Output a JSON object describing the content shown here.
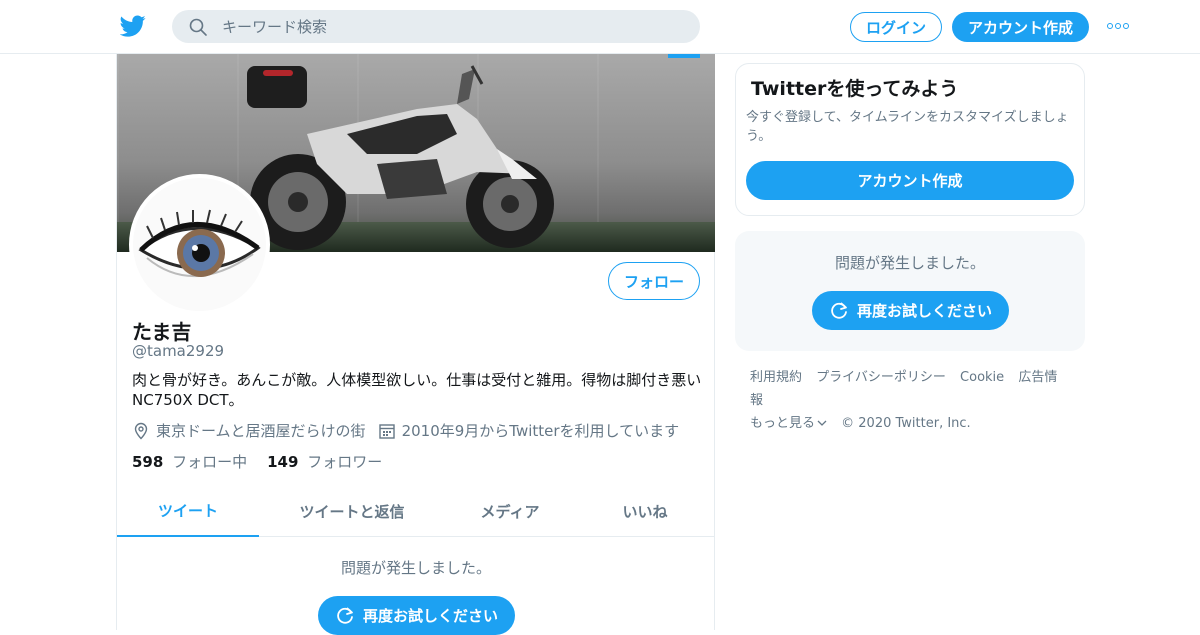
{
  "header": {
    "search_placeholder": "キーワード検索",
    "login_label": "ログイン",
    "signup_label": "アカウント作成",
    "more_icon": "more-dots-icon"
  },
  "profile": {
    "name": "たま吉",
    "handle": "@tama2929",
    "bio": "肉と骨が好き。あんこが敵。人体模型欲しい。仕事は受付と雑用。得物は脚付き悪いNC750X DCT。",
    "location": "東京ドームと居酒屋だらけの街",
    "joined": "2010年9月からTwitterを利用しています",
    "following_count": "598",
    "following_label": "フォロー中",
    "followers_count": "149",
    "followers_label": "フォロワー",
    "follow_label": "フォロー"
  },
  "tabs": [
    {
      "label": "ツイート"
    },
    {
      "label": "ツイートと返信"
    },
    {
      "label": "メディア"
    },
    {
      "label": "いいね"
    }
  ],
  "timeline": {
    "error_text": "問題が発生しました。",
    "retry_label": "再度お試しください"
  },
  "sidebar": {
    "card_title": "Twitterを使ってみよう",
    "card_text": "今すぐ登録して、タイムラインをカスタマイズしましょう。",
    "card_button": "アカウント作成",
    "error_text": "問題が発生しました。",
    "retry_label": "再度お試しください"
  },
  "footer": {
    "links": [
      "利用規約",
      "プライバシーポリシー",
      "Cookie",
      "広告情報"
    ],
    "more_label": "もっと見る",
    "copyright": "© 2020 Twitter, Inc."
  },
  "colors": {
    "accent": "#1da1f2",
    "secondary_text": "#657786",
    "border": "#e6ecf0"
  }
}
